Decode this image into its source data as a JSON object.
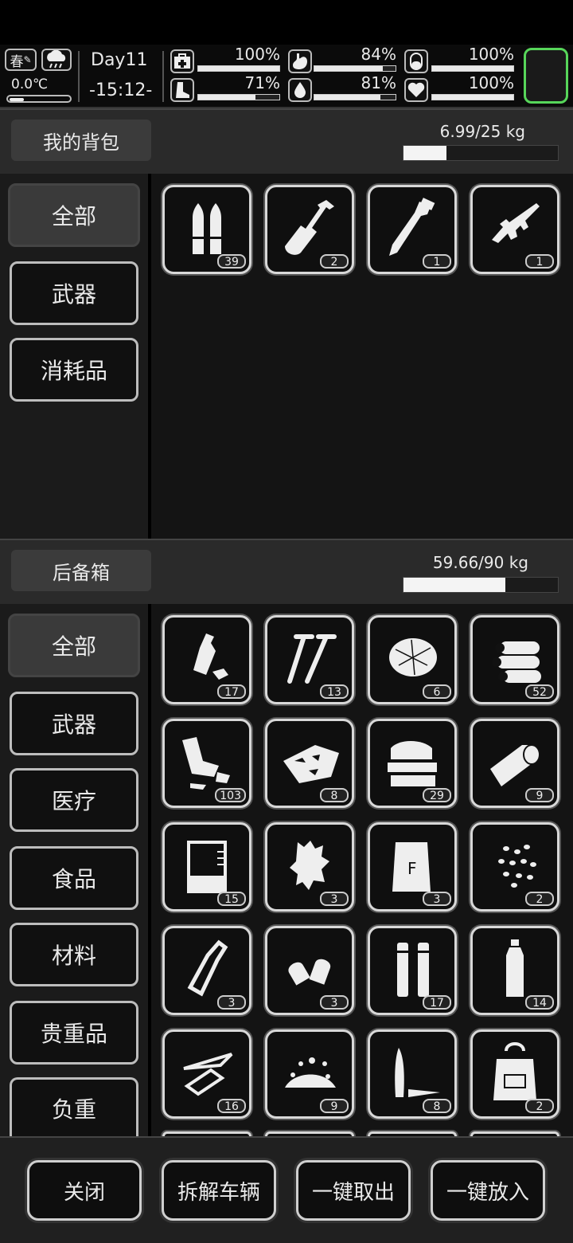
{
  "status": {
    "season": "春",
    "weather_icon": "rain-cloud-icon",
    "temperature": "0.0℃",
    "temp_level": 0.18,
    "day": "Day11",
    "clock": "-15:12-",
    "stats": [
      {
        "icon": "medkit-icon",
        "value": "100%",
        "level": 1.0
      },
      {
        "icon": "stomach-icon",
        "value": "84%",
        "level": 0.84
      },
      {
        "icon": "capsule-icon",
        "value": "100%",
        "level": 1.0
      },
      {
        "icon": "boot-icon",
        "value": "71%",
        "level": 0.71
      },
      {
        "icon": "water-drop-icon",
        "value": "81%",
        "level": 0.81
      },
      {
        "icon": "heart-icon",
        "value": "100%",
        "level": 1.0
      }
    ],
    "accent": "#57d65a"
  },
  "backpack": {
    "title": "我的背包",
    "weight": "6.99/25 kg",
    "weight_level": 0.2796,
    "categories": [
      "全部",
      "武器",
      "消耗品"
    ],
    "active_category": "全部",
    "items": [
      {
        "icon": "bullets-icon",
        "count": "39"
      },
      {
        "icon": "shovel-icon",
        "count": "2"
      },
      {
        "icon": "machete-icon",
        "count": "1"
      },
      {
        "icon": "rifle-icon",
        "count": "1"
      }
    ]
  },
  "trunk": {
    "title": "后备箱",
    "weight": "59.66/90 kg",
    "weight_level": 0.6629,
    "categories": [
      "全部",
      "武器",
      "医疗",
      "食品",
      "材料",
      "贵重品",
      "负重"
    ],
    "active_category": "全部",
    "items": [
      {
        "icon": "plastic-bottle-trash-icon",
        "count": "17"
      },
      {
        "icon": "screws-icon",
        "count": "13"
      },
      {
        "icon": "fiber-ball-icon",
        "count": "6"
      },
      {
        "icon": "logs-icon",
        "count": "52"
      },
      {
        "icon": "cloth-rags-icon",
        "count": "103"
      },
      {
        "icon": "scrap-plates-icon",
        "count": "8"
      },
      {
        "icon": "folded-cloth-icon",
        "count": "29"
      },
      {
        "icon": "tape-roll-icon",
        "count": "9"
      },
      {
        "icon": "beaker-icon",
        "count": "15"
      },
      {
        "icon": "ginger-root-icon",
        "count": "3"
      },
      {
        "icon": "flour-bag-icon",
        "count": "3"
      },
      {
        "icon": "seeds-icon",
        "count": "2"
      },
      {
        "icon": "glass-bottle-icon",
        "count": "3"
      },
      {
        "icon": "earplugs-icon",
        "count": "3"
      },
      {
        "icon": "cartridges-icon",
        "count": "17"
      },
      {
        "icon": "water-bottle-icon",
        "count": "14"
      },
      {
        "icon": "glass-shards-icon",
        "count": "16"
      },
      {
        "icon": "gravel-icon",
        "count": "9"
      },
      {
        "icon": "knife-blades-icon",
        "count": "8"
      },
      {
        "icon": "backpack-icon",
        "count": "2"
      }
    ]
  },
  "footer": {
    "buttons": [
      "关闭",
      "拆解车辆",
      "一键取出",
      "一键放入"
    ]
  }
}
